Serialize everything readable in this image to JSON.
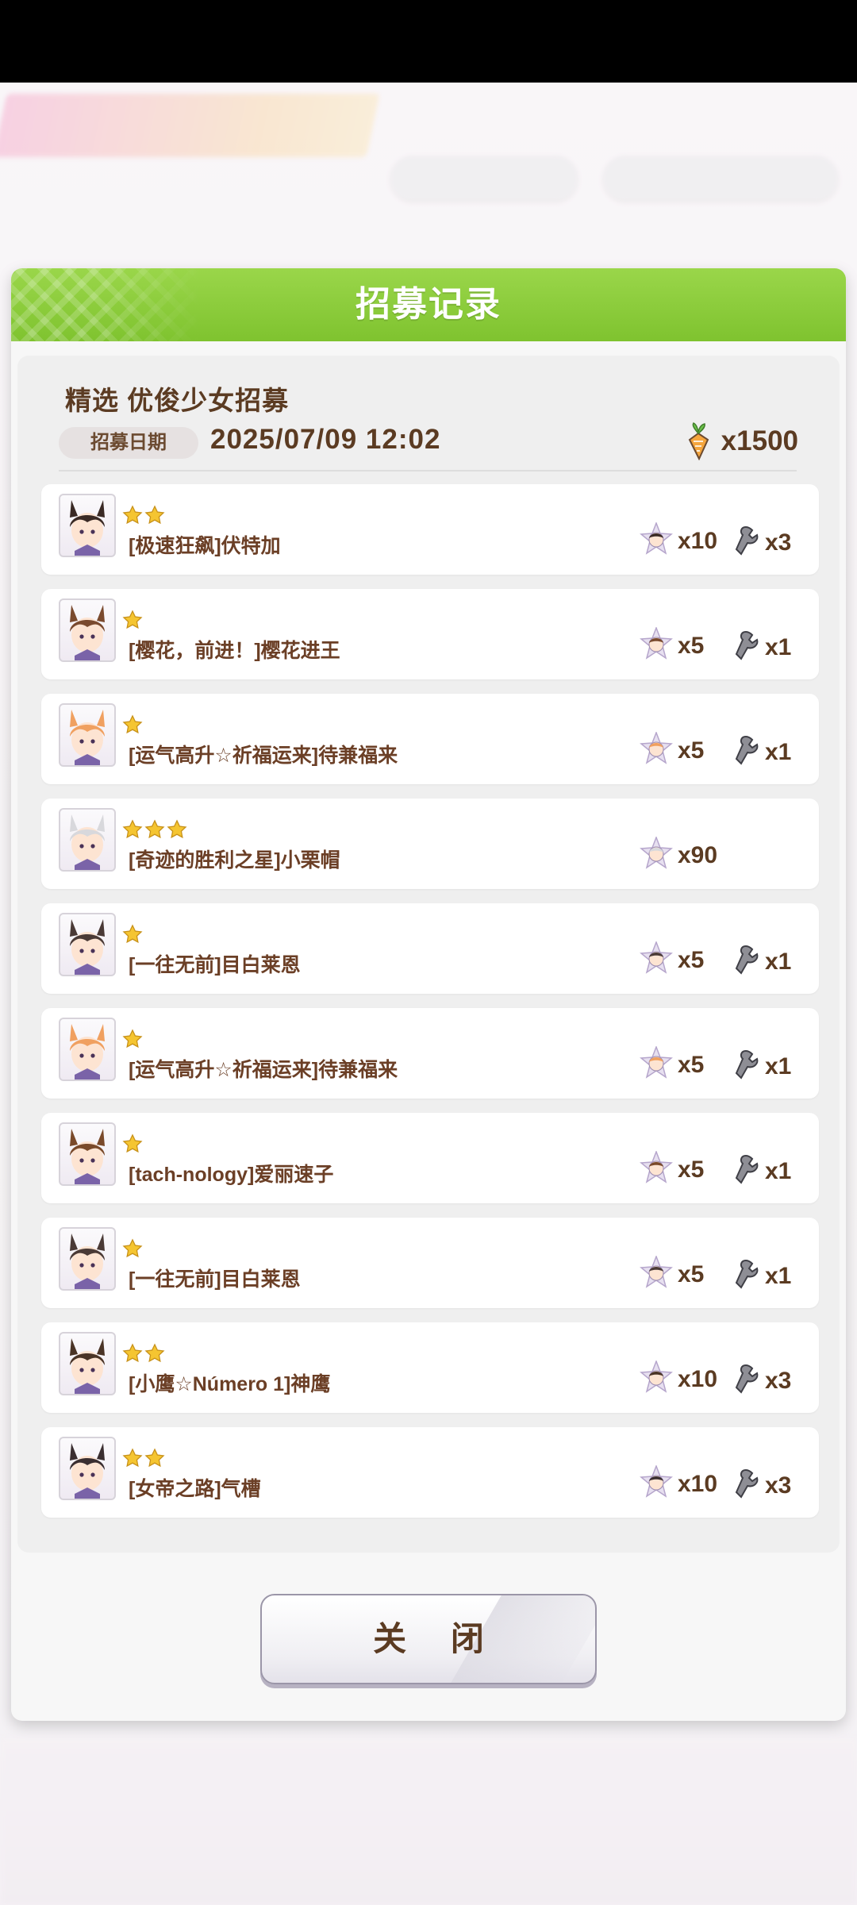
{
  "dialog": {
    "title": "招募记录",
    "banner_name": "精选 优俊少女招募",
    "date_label": "招募日期",
    "date_value": "2025/07/09 12:02",
    "cost": {
      "icon": "carrot-ticket-icon",
      "amount": "x1500"
    },
    "close_label": "关 闭"
  },
  "results": [
    {
      "stars": 2,
      "name": "[极速狂飙]伏特加",
      "piece_qty": "x10",
      "point_qty": "x3",
      "hair": "#3a2a25"
    },
    {
      "stars": 1,
      "name": "[樱花，前进！]樱花进王",
      "piece_qty": "x5",
      "point_qty": "x1",
      "hair": "#7a4a2e"
    },
    {
      "stars": 1,
      "name": "[运气高升☆祈福运来]待兼福来",
      "piece_qty": "x5",
      "point_qty": "x1",
      "hair": "#f0a060"
    },
    {
      "stars": 3,
      "name": "[奇迹的胜利之星]小栗帽",
      "piece_qty": "x90",
      "point_qty": "",
      "hair": "#d8d8dc"
    },
    {
      "stars": 1,
      "name": "[一往无前]目白莱恩",
      "piece_qty": "x5",
      "point_qty": "x1",
      "hair": "#4a3a36"
    },
    {
      "stars": 1,
      "name": "[运气高升☆祈福运来]待兼福来",
      "piece_qty": "x5",
      "point_qty": "x1",
      "hair": "#f0a060"
    },
    {
      "stars": 1,
      "name": "[tach-nology]爱丽速子",
      "piece_qty": "x5",
      "point_qty": "x1",
      "hair": "#7a4a2a"
    },
    {
      "stars": 1,
      "name": "[一往无前]目白莱恩",
      "piece_qty": "x5",
      "point_qty": "x1",
      "hair": "#4a3a36"
    },
    {
      "stars": 2,
      "name": "[小鹰☆Número 1]神鹰",
      "piece_qty": "x10",
      "point_qty": "x3",
      "hair": "#4a3426"
    },
    {
      "stars": 2,
      "name": "[女帝之路]气槽",
      "piece_qty": "x10",
      "point_qty": "x3",
      "hair": "#3a2e30"
    }
  ],
  "colors": {
    "header_green": "#8cce3c",
    "text_brown": "#5b3b22",
    "star_gold": "#f5c531"
  }
}
